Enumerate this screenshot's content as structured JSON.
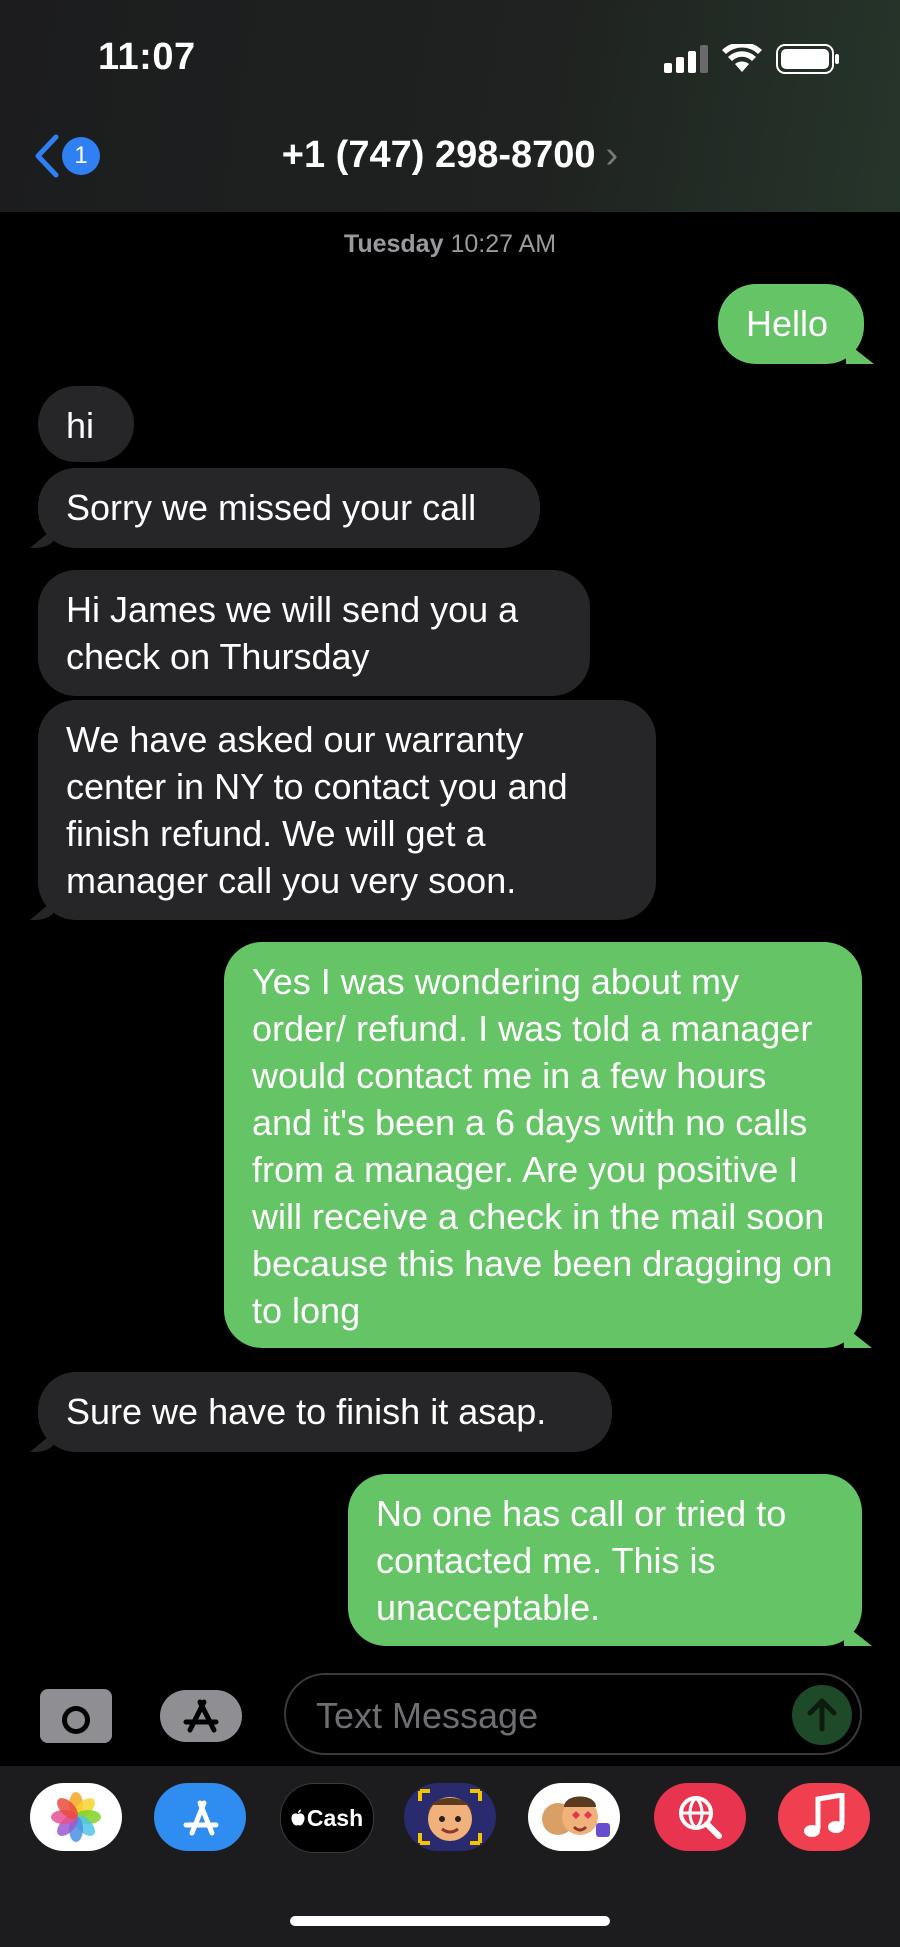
{
  "status": {
    "time": "11:07"
  },
  "nav": {
    "back_badge": "1",
    "contact": "+1 (747) 298-8700",
    "chevron": "›"
  },
  "timestamp": {
    "day": "Tuesday",
    "time": "10:27 AM"
  },
  "messages": [
    {
      "dir": "out",
      "text": "Hello"
    },
    {
      "dir": "in",
      "text": "hi"
    },
    {
      "dir": "in",
      "text": "Sorry we missed your call"
    },
    {
      "dir": "in",
      "text": "Hi James we will send you a check on Thursday"
    },
    {
      "dir": "in",
      "text": "We have asked our warranty center in NY to contact you and finish refund. We will get a manager call you very soon."
    },
    {
      "dir": "out",
      "text": "Yes I was wondering about my order/ refund. I was told a manager would contact me in a few hours and it's been a 6 days with no calls from a manager. Are you positive I will receive a check in the mail soon because this have been dragging on to long"
    },
    {
      "dir": "in",
      "text": "Sure we have to finish it asap."
    },
    {
      "dir": "out",
      "text": "No one has call or tried to contacted me. This is unacceptable."
    }
  ],
  "composer": {
    "placeholder": "Text Message"
  },
  "apps": [
    {
      "name": "photos-app-icon"
    },
    {
      "name": "app-store-icon"
    },
    {
      "name": "apple-cash-icon",
      "label": "Cash"
    },
    {
      "name": "memoji-icon"
    },
    {
      "name": "memoji-stickers-icon"
    },
    {
      "name": "web-search-icon"
    },
    {
      "name": "music-icon"
    }
  ],
  "colors": {
    "outgoing": "#65c466",
    "incoming": "#262628",
    "link": "#2f80f2"
  }
}
